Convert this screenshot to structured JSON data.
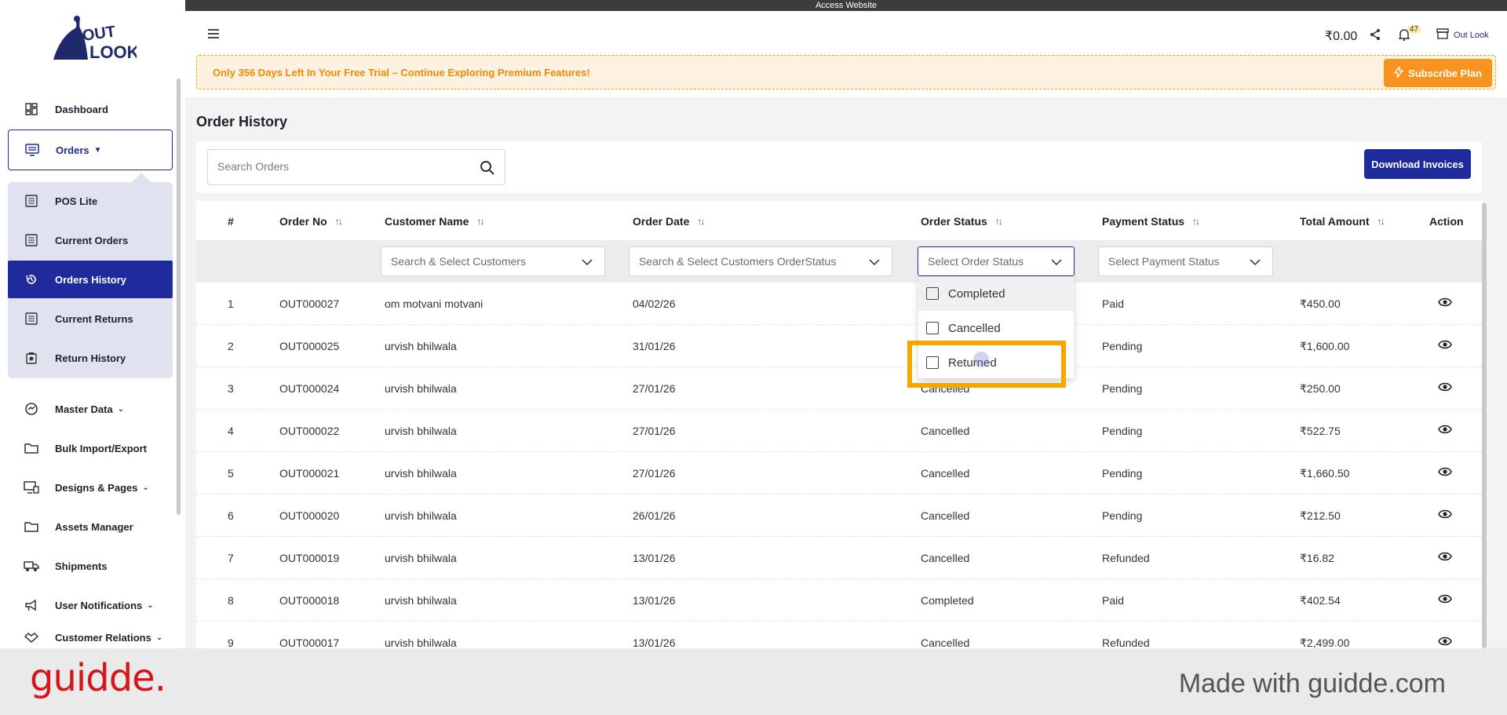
{
  "topbar": {
    "text": "Access Website"
  },
  "brand": {
    "logo_top": "OUT",
    "logo_bottom": "LOOK"
  },
  "sidebar": {
    "items": [
      {
        "label": "Dashboard",
        "icon": "dashboard-icon"
      },
      {
        "label": "Orders",
        "icon": "orders-icon"
      },
      {
        "label": "POS Lite",
        "icon": "list-icon"
      },
      {
        "label": "Current Orders",
        "icon": "list-icon"
      },
      {
        "label": "Orders History",
        "icon": "history-icon"
      },
      {
        "label": "Current Returns",
        "icon": "list-icon"
      },
      {
        "label": "Return History",
        "icon": "return-icon"
      },
      {
        "label": "Master Data",
        "icon": "master-data-icon"
      },
      {
        "label": "Bulk Import/Export",
        "icon": "folder-icon"
      },
      {
        "label": "Designs & Pages",
        "icon": "design-icon"
      },
      {
        "label": "Assets Manager",
        "icon": "folder-icon"
      },
      {
        "label": "Shipments",
        "icon": "truck-icon"
      },
      {
        "label": "User Notifications",
        "icon": "megaphone-icon"
      },
      {
        "label": "Customer Relations",
        "icon": "handshake-icon"
      }
    ]
  },
  "header": {
    "balance": "₹0.00",
    "notification_count": "47",
    "store_name": "Out Look",
    "trial_text": "Only 356 Days Left In Your Free Trial – Continue Exploring Premium Features!",
    "subscribe_label": "Subscribe Plan"
  },
  "main": {
    "title": "Order History",
    "search_placeholder": "Search Orders",
    "download_label": "Download Invoices"
  },
  "table": {
    "columns": [
      "#",
      "Order No",
      "Customer Name",
      "Order Date",
      "Order Status",
      "Payment Status",
      "Total Amount",
      "Action"
    ],
    "filters": {
      "customer": "Search & Select Customers",
      "order_status_search": "Search & Select Customers OrderStatus",
      "order_status": "Select Order Status",
      "payment_status": "Select Payment Status"
    },
    "rows": [
      {
        "n": "1",
        "order_no": "OUT000027",
        "customer": "om motvani motvani",
        "date": "04/02/26",
        "status": "",
        "payment": "Paid",
        "amount": "₹450.00"
      },
      {
        "n": "2",
        "order_no": "OUT000025",
        "customer": "urvish bhilwala",
        "date": "31/01/26",
        "status": "",
        "payment": "Pending",
        "amount": "₹1,600.00"
      },
      {
        "n": "3",
        "order_no": "OUT000024",
        "customer": "urvish bhilwala",
        "date": "27/01/26",
        "status": "Cancelled",
        "payment": "Pending",
        "amount": "₹250.00"
      },
      {
        "n": "4",
        "order_no": "OUT000022",
        "customer": "urvish bhilwala",
        "date": "27/01/26",
        "status": "Cancelled",
        "payment": "Pending",
        "amount": "₹522.75"
      },
      {
        "n": "5",
        "order_no": "OUT000021",
        "customer": "urvish bhilwala",
        "date": "27/01/26",
        "status": "Cancelled",
        "payment": "Pending",
        "amount": "₹1,660.50"
      },
      {
        "n": "6",
        "order_no": "OUT000020",
        "customer": "urvish bhilwala",
        "date": "26/01/26",
        "status": "Cancelled",
        "payment": "Pending",
        "amount": "₹212.50"
      },
      {
        "n": "7",
        "order_no": "OUT000019",
        "customer": "urvish bhilwala",
        "date": "13/01/26",
        "status": "Cancelled",
        "payment": "Refunded",
        "amount": "₹16.82"
      },
      {
        "n": "8",
        "order_no": "OUT000018",
        "customer": "urvish bhilwala",
        "date": "13/01/26",
        "status": "Completed",
        "payment": "Paid",
        "amount": "₹402.54"
      },
      {
        "n": "9",
        "order_no": "OUT000017",
        "customer": "urvish bhilwala",
        "date": "13/01/26",
        "status": "Cancelled",
        "payment": "Refunded",
        "amount": "₹2,499.00"
      }
    ]
  },
  "dropdown": {
    "options": [
      "Completed",
      "Cancelled",
      "Returned"
    ]
  },
  "footer": {
    "logo": "guidde.",
    "tagline": "Made with guidde.com"
  },
  "colors": {
    "primary": "#1f2a9c",
    "accent_orange": "#f7931e",
    "highlight": "#f7a500",
    "brand_red": "#d4161c"
  }
}
